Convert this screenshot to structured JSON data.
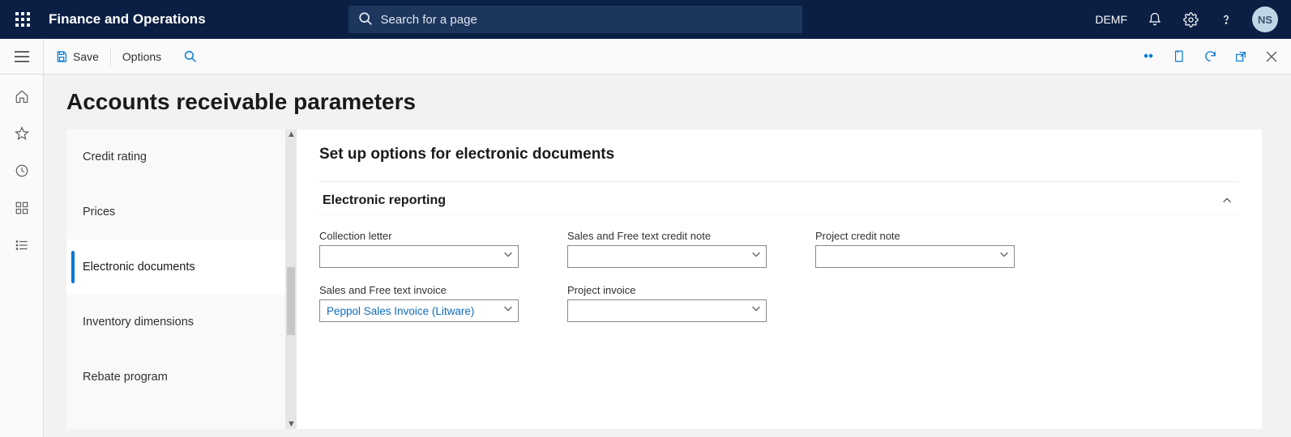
{
  "header": {
    "app_title": "Finance and Operations",
    "search_placeholder": "Search for a page",
    "company": "DEMF",
    "user_initials": "NS"
  },
  "commandbar": {
    "save_label": "Save",
    "options_label": "Options"
  },
  "page": {
    "title": "Accounts receivable parameters"
  },
  "side_tabs": {
    "items": [
      {
        "label": "Credit rating"
      },
      {
        "label": "Prices"
      },
      {
        "label": "Electronic documents"
      },
      {
        "label": "Inventory dimensions"
      },
      {
        "label": "Rebate program"
      }
    ],
    "active_index": 2
  },
  "section": {
    "title": "Set up options for electronic documents",
    "group_title": "Electronic reporting"
  },
  "fields": {
    "collection_letter": {
      "label": "Collection letter",
      "value": ""
    },
    "sales_free_credit_note": {
      "label": "Sales and Free text credit note",
      "value": ""
    },
    "project_credit_note": {
      "label": "Project credit note",
      "value": ""
    },
    "sales_free_invoice": {
      "label": "Sales and Free text invoice",
      "value": "Peppol Sales Invoice (Litware)"
    },
    "project_invoice": {
      "label": "Project invoice",
      "value": ""
    }
  }
}
